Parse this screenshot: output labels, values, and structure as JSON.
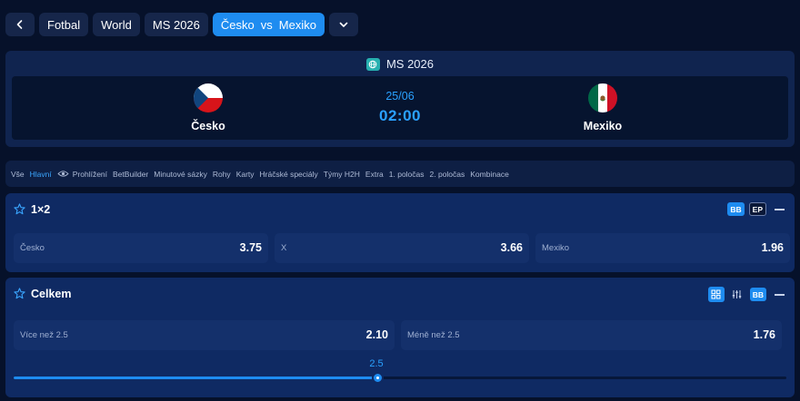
{
  "breadcrumb": {
    "back_icon": "chevron-left-icon",
    "sport": "Fotbal",
    "region": "World",
    "competition": "MS 2026",
    "event": {
      "home": "Česko",
      "vs": "vs",
      "away": "Mexiko"
    },
    "more_icon": "chevron-down-icon"
  },
  "match": {
    "competition": "MS 2026",
    "competition_icon": "globe-icon",
    "home": {
      "name": "Česko",
      "flag": "czech-flag-icon"
    },
    "away": {
      "name": "Mexiko",
      "flag": "mexico-flag-icon"
    },
    "date": "25/06",
    "time": "02:00"
  },
  "tabs": [
    {
      "label": "Vše",
      "active": false
    },
    {
      "label": "Hlavní",
      "active": true
    },
    {
      "label": "Prohlížení",
      "active": false,
      "icon": "eye-icon"
    },
    {
      "label": "BetBuilder",
      "active": false
    },
    {
      "label": "Minutové sázky",
      "active": false
    },
    {
      "label": "Rohy",
      "active": false
    },
    {
      "label": "Karty",
      "active": false
    },
    {
      "label": "Hráčské speciály",
      "active": false
    },
    {
      "label": "Týmy H2H",
      "active": false
    },
    {
      "label": "Extra",
      "active": false
    },
    {
      "label": "1. poločas",
      "active": false
    },
    {
      "label": "2. poločas",
      "active": false
    },
    {
      "label": "Kombinace",
      "active": false
    }
  ],
  "markets": {
    "one_x_two": {
      "title": "1×2",
      "badges": {
        "bb": "BB",
        "ep": "EP"
      },
      "selections": [
        {
          "label": "Česko",
          "odds": "3.75"
        },
        {
          "label": "X",
          "odds": "3.66"
        },
        {
          "label": "Mexiko",
          "odds": "1.96"
        }
      ]
    },
    "total": {
      "title": "Celkem",
      "badges": {
        "bb": "BB"
      },
      "selections": [
        {
          "label": "Více než 2.5",
          "odds": "2.10"
        },
        {
          "label": "Méně než 2.5",
          "odds": "1.76"
        }
      ],
      "line": {
        "value": "2.5",
        "fraction": 0.47
      }
    }
  },
  "colors": {
    "background": "#06112a",
    "accent": "#1e8cf0",
    "accent_text": "#2aa1ff",
    "panel": "#0f2a63",
    "competition_badge": "#27b0b0"
  }
}
